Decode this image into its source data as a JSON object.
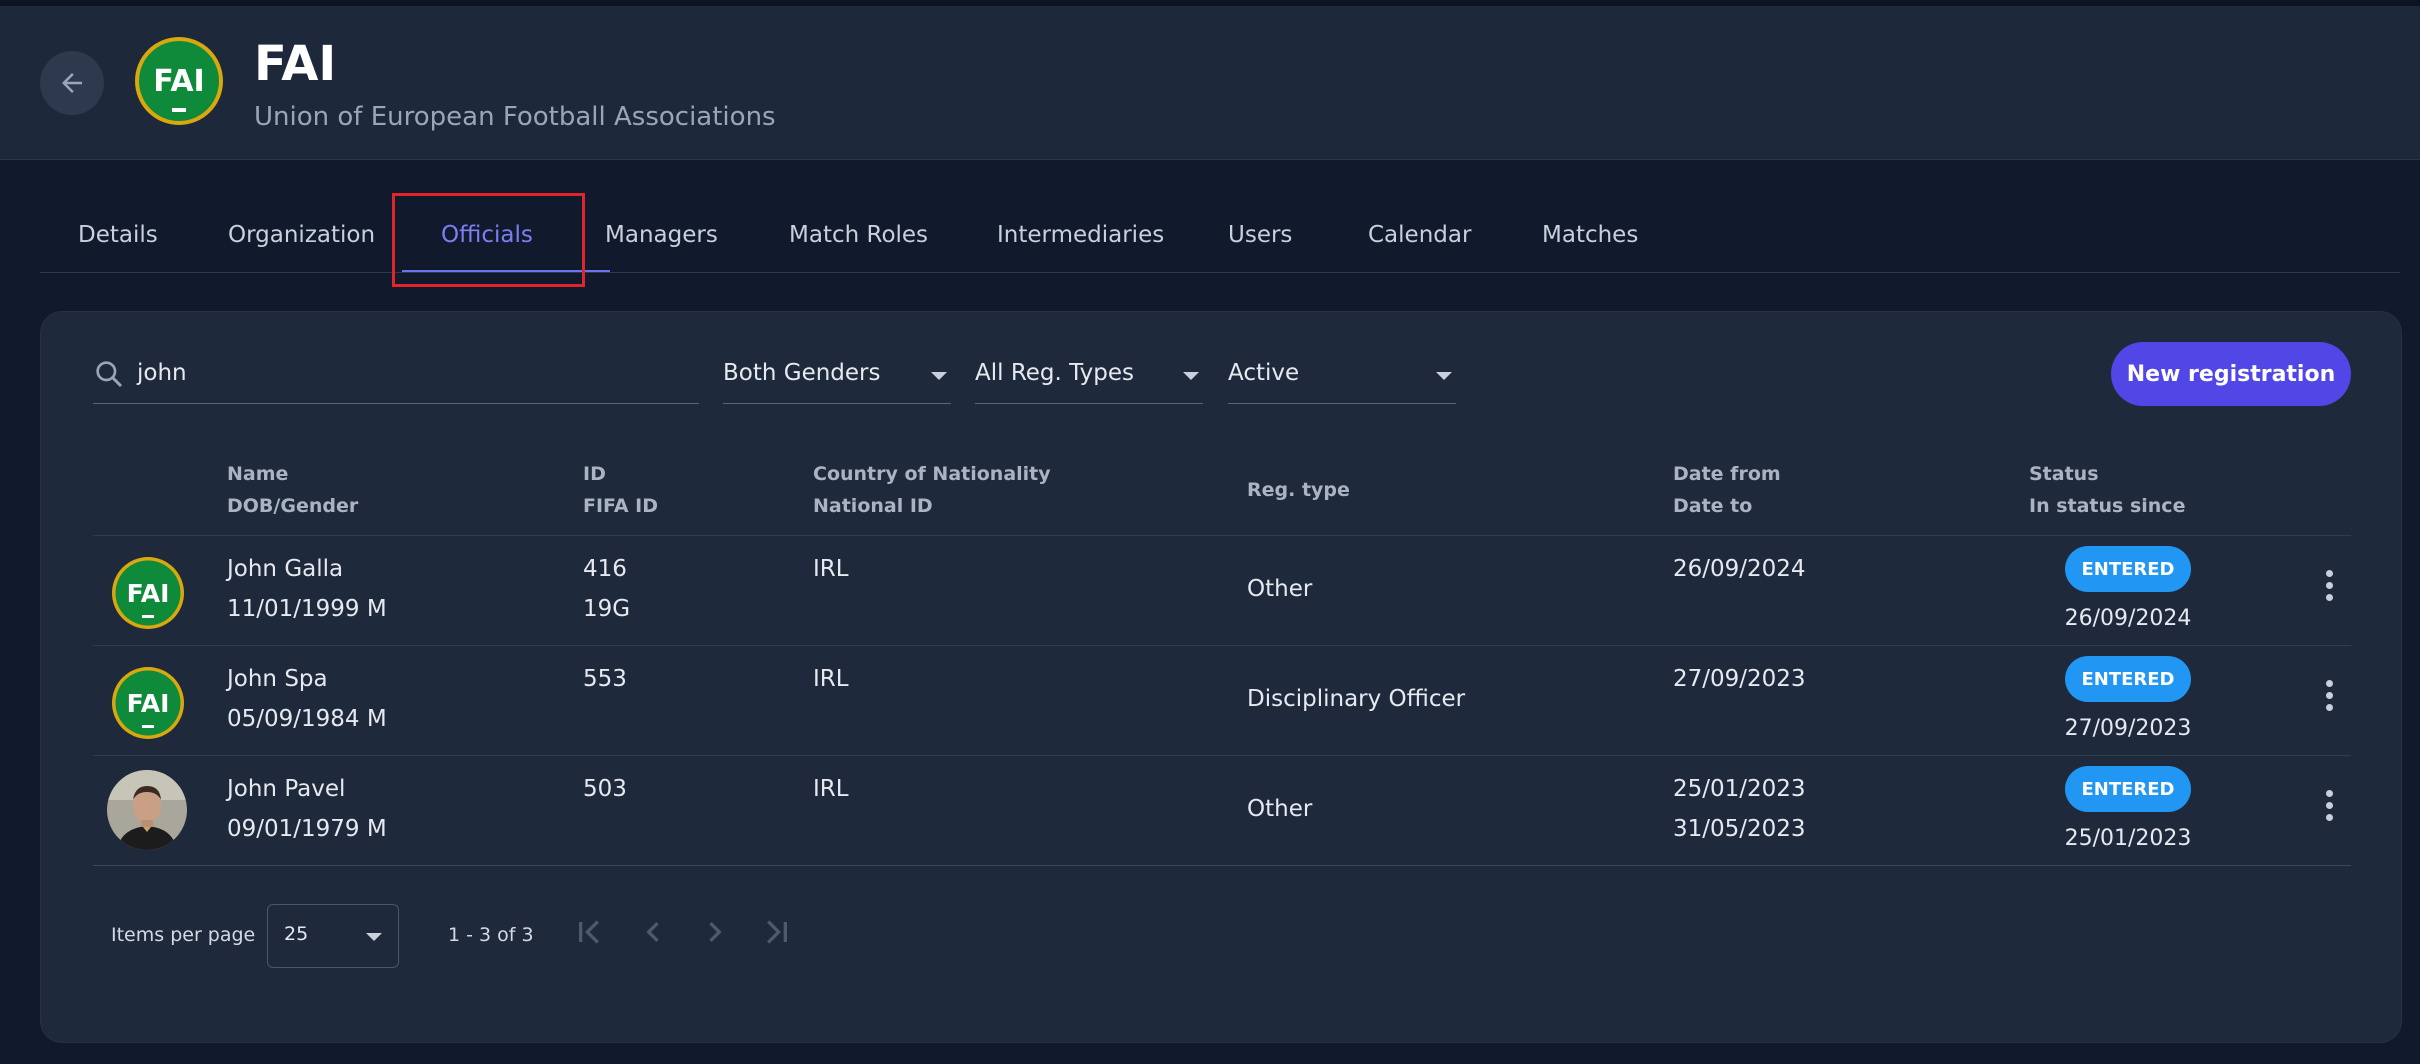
{
  "header": {
    "org_code": "FAI",
    "org_name": "Union of European Football Associations",
    "logo_text": "FAI"
  },
  "tabs": [
    {
      "label": "Details"
    },
    {
      "label": "Organization"
    },
    {
      "label": "Officials"
    },
    {
      "label": "Managers"
    },
    {
      "label": "Match Roles"
    },
    {
      "label": "Intermediaries"
    },
    {
      "label": "Users"
    },
    {
      "label": "Calendar"
    },
    {
      "label": "Matches"
    }
  ],
  "active_tab": "Officials",
  "filters": {
    "search_value": "john",
    "gender": "Both Genders",
    "reg_type": "All Reg. Types",
    "status": "Active"
  },
  "actions": {
    "new_registration": "New registration"
  },
  "table": {
    "headers": {
      "name": "Name",
      "dob_gender": "DOB/Gender",
      "id": "ID",
      "fifa_id": "FIFA ID",
      "country": "Country of Nationality",
      "national_id": "National ID",
      "reg_type": "Reg. type",
      "date_from": "Date from",
      "date_to": "Date to",
      "status": "Status",
      "status_since": "In status since"
    },
    "rows": [
      {
        "name": "John Galla",
        "dob_gender": "11/01/1999 M",
        "id": "416",
        "fifa_id": "19G",
        "country": "IRL",
        "reg_type": "Other",
        "date_from": "26/09/2024",
        "date_to": "",
        "status": "ENTERED",
        "status_since": "26/09/2024",
        "avatar": "fai-logo"
      },
      {
        "name": "John Spa",
        "dob_gender": "05/09/1984 M",
        "id": "553",
        "fifa_id": "",
        "country": "IRL",
        "reg_type": "Disciplinary Officer",
        "date_from": "27/09/2023",
        "date_to": "",
        "status": "ENTERED",
        "status_since": "27/09/2023",
        "avatar": "fai-logo"
      },
      {
        "name": "John Pavel",
        "dob_gender": "09/01/1979 M",
        "id": "503",
        "fifa_id": "",
        "country": "IRL",
        "reg_type": "Other",
        "date_from": "25/01/2023",
        "date_to": "31/05/2023",
        "status": "ENTERED",
        "status_since": "25/01/2023",
        "avatar": "photo"
      }
    ]
  },
  "pagination": {
    "items_per_page_label": "Items per page",
    "items_per_page": "25",
    "range": "1 - 3 of 3"
  },
  "colors": {
    "accent": "#5146e6",
    "active_tab": "#7b7ff3",
    "badge": "#2196f3",
    "highlight": "#e0262b"
  }
}
